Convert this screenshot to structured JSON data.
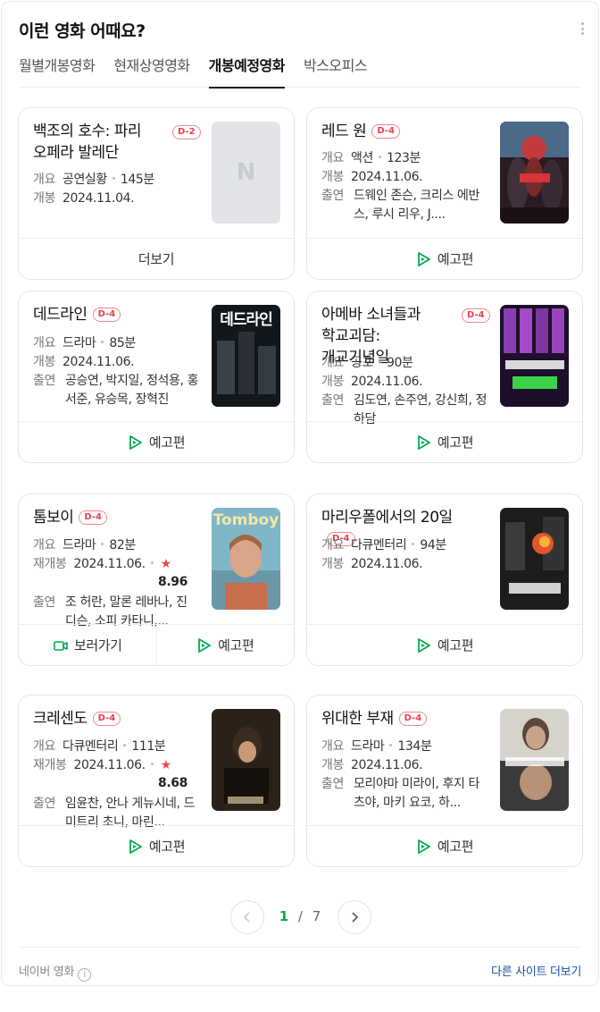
{
  "header": {
    "title": "이런 영화 어때요?"
  },
  "tabs": [
    {
      "label": "월별개봉영화"
    },
    {
      "label": "현재상영영화"
    },
    {
      "label": "개봉예정영화"
    },
    {
      "label": "박스오피스"
    }
  ],
  "labels": {
    "genre": "개요",
    "release": "개봉",
    "rerelease": "재개봉",
    "cast": "출연"
  },
  "cards": [
    {
      "title": "백조의 호수: 파리 오페라 발레단",
      "badge": "D-2",
      "genre": "공연실황",
      "runtime": "145분",
      "date": "2024.11.04.",
      "footer": "더보기",
      "poster_letter": "N"
    },
    {
      "title": "레드 원",
      "badge": "D-4",
      "genre": "액션",
      "runtime": "123분",
      "date": "2024.11.06.",
      "cast": "드웨인 존슨, 크리스 에반스, 루시 리우, J....",
      "footer": "예고편"
    },
    {
      "title": "데드라인",
      "badge": "D-4",
      "genre": "드라마",
      "runtime": "85분",
      "date": "2024.11.06.",
      "cast": "공승연, 박지일, 정석용, 홍서준, 유승목, 장혁진",
      "footer": "예고편",
      "poster_text": "데드라인"
    },
    {
      "title": "아메바 소녀들과 학교괴담: 개교기념일",
      "badge": "D-4",
      "genre": "공포",
      "runtime": "90분",
      "date": "2024.11.06.",
      "cast": "김도연, 손주연, 강신희, 정하담",
      "footer": "예고편"
    },
    {
      "title": "톰보이",
      "badge": "D-4",
      "genre": "드라마",
      "runtime": "82분",
      "date": "2024.11.06.",
      "rating": "8.96",
      "cast": "조 허란, 말론 레바나, 진 디슨, 소피 카타니,...",
      "footer_watch": "보러가기",
      "footer": "예고편",
      "poster_text": "Tomboy"
    },
    {
      "title": "마리우폴에서의 20일",
      "badge": "D-4",
      "genre": "다큐멘터리",
      "runtime": "94분",
      "date": "2024.11.06.",
      "footer": "예고편"
    },
    {
      "title": "크레센도",
      "badge": "D-4",
      "genre": "다큐멘터리",
      "runtime": "111분",
      "date": "2024.11.06.",
      "rating": "8.68",
      "cast": "임윤찬, 안나 게뉴시네, 드미트리 초니, 마린...",
      "footer": "예고편"
    },
    {
      "title": "위대한 부재",
      "badge": "D-4",
      "genre": "드라마",
      "runtime": "134분",
      "date": "2024.11.06.",
      "cast": "모리야마 미라이, 후지 타츠야, 마키 요코, 하...",
      "footer": "예고편"
    }
  ],
  "pager": {
    "current": "1",
    "sep": "/",
    "total": "7"
  },
  "footer": {
    "source": "네이버 영화",
    "other": "다른 사이트 더보기"
  },
  "colors": {
    "accent": "#03a94d",
    "badge": "#e8404f",
    "link": "#1a4fa0"
  }
}
